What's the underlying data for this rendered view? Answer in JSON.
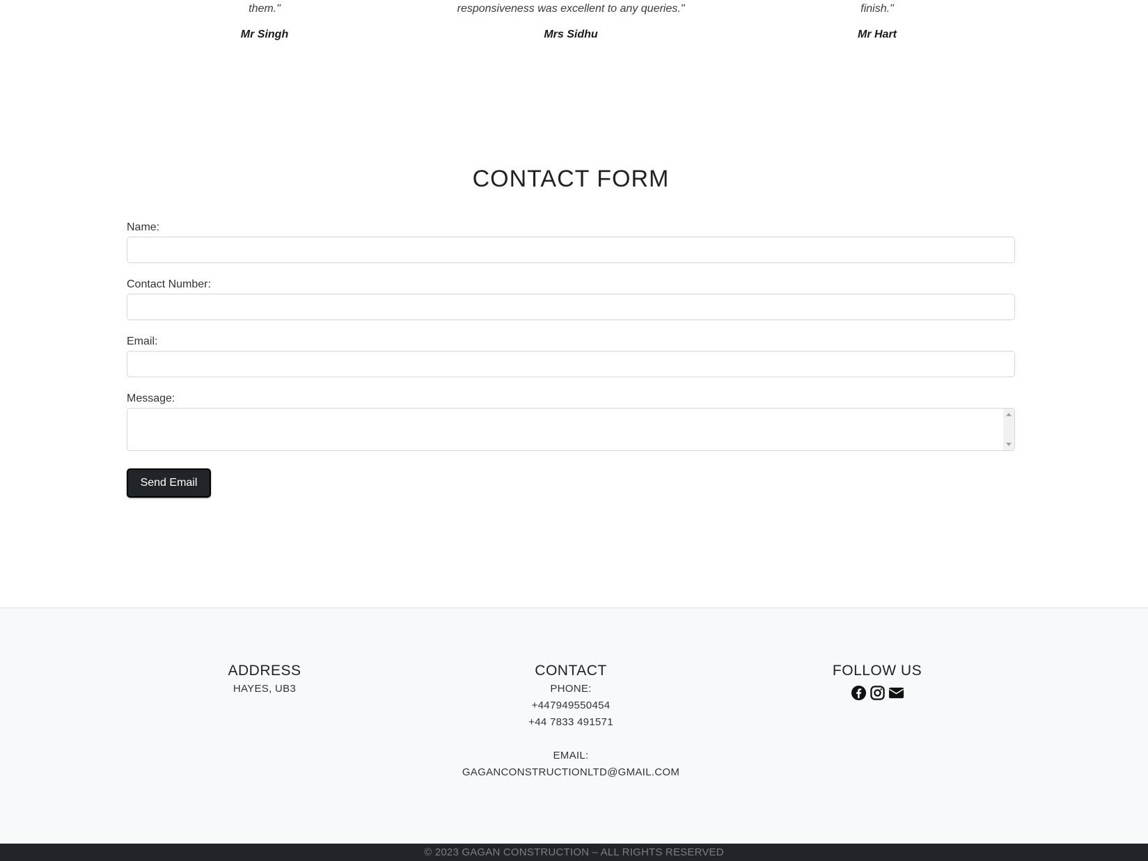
{
  "testimonials": [
    {
      "quote": "them.\"",
      "author": "Mr Singh"
    },
    {
      "quote": "responsiveness was excellent to any queries.\"",
      "author": "Mrs Sidhu"
    },
    {
      "quote": "finish.\"",
      "author": "Mr Hart"
    }
  ],
  "contact_form": {
    "title": "CONTACT FORM",
    "name_label": "Name:",
    "name_value": "",
    "phone_label": "Contact Number:",
    "phone_value": "",
    "email_label": "Email:",
    "email_value": "",
    "message_label": "Message:",
    "message_value": "",
    "submit_label": "Send Email"
  },
  "footer": {
    "address": {
      "heading": "ADDRESS",
      "text": "HAYES, UB3"
    },
    "contact": {
      "heading": "CONTACT",
      "phone_label": "PHONE:",
      "phone_1": "+447949550454",
      "phone_2": "+44 7833 491571",
      "email_label": "EMAIL:",
      "email": "GAGANCONSTRUCTIONLTD@GMAIL.COM"
    },
    "follow": {
      "heading": "FOLLOW US",
      "icons": [
        "facebook-icon",
        "instagram-icon",
        "envelope-icon"
      ]
    },
    "copyright": "© 2023 GAGAN CONSTRUCTION – ALL RIGHTS RESERVED"
  },
  "colors": {
    "button_bg": "#212529",
    "footer_bg": "#f8f9fa",
    "copyright_bg": "#212529"
  }
}
